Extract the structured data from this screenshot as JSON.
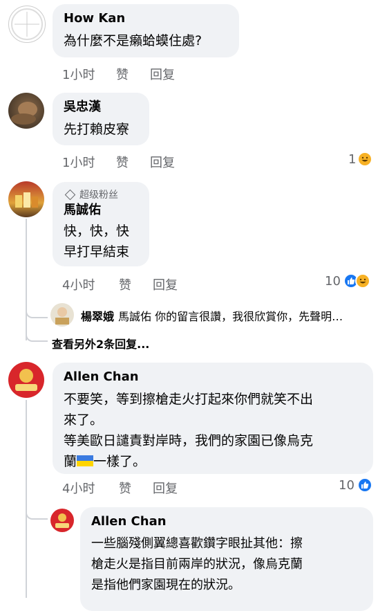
{
  "comments": [
    {
      "author": "How Kan",
      "lines": [
        "為什麼不是癩蛤蟆住處?"
      ],
      "time": "1小时",
      "like": "赞",
      "reply": "回复"
    },
    {
      "author": "吳忠漢",
      "lines": [
        "先打賴皮寮"
      ],
      "time": "1小时",
      "like": "赞",
      "reply": "回复",
      "reaction_count": "1"
    },
    {
      "author": "馬誠佑",
      "badge": "超级粉丝",
      "lines": [
        "快，快，快",
        "早打早結束"
      ],
      "time": "4小时",
      "like": "赞",
      "reply": "回复",
      "reaction_count": "10"
    },
    {
      "author": "Allen Chan",
      "lines": [
        "不要笑，等到擦槍走火打起來你們就笑不出",
        "來了。",
        "等美歐日譴責對岸時，我們的家園已像烏克",
        "蘭",
        "一樣了。"
      ],
      "time": "4小时",
      "like": "赞",
      "reply": "回复",
      "reaction_count": "10"
    }
  ],
  "reply_preview": {
    "author": "楊翠娥",
    "text": "馬誠佑 你的留言很讚，我很欣賞你，先聲明…"
  },
  "more_replies": "查看另外2条回复...",
  "nested_reply": {
    "author": "Allen Chan",
    "lines": [
      "一些腦殘側翼總喜歡鑽字眼扯其他：擦",
      "槍走火是指目前兩岸的狀況，像烏克蘭",
      "是指他們家園現在的狀況。"
    ]
  },
  "colors": {
    "bubble": "#f0f2f5",
    "meta": "#65676b",
    "like_blue": "#1877f2",
    "laugh_yellow": "#f7b125"
  }
}
